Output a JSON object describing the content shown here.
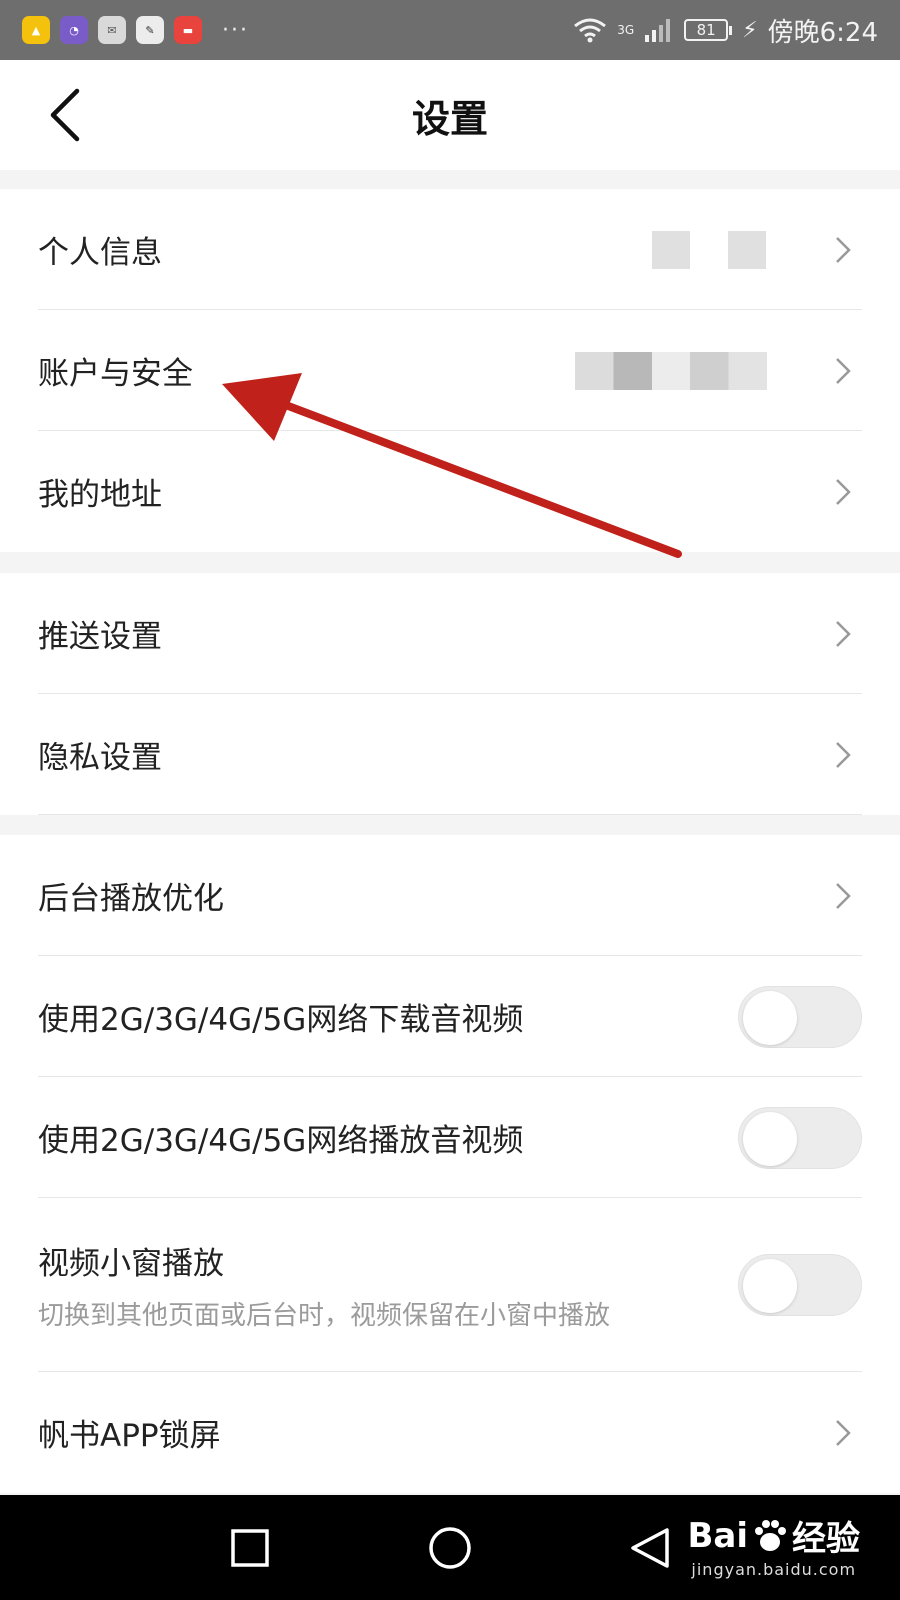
{
  "status_bar": {
    "time": "傍晚6:24",
    "battery": "81",
    "network": "3G"
  },
  "header": {
    "title": "设置"
  },
  "groups": {
    "account": {
      "items": [
        {
          "label": "个人信息"
        },
        {
          "label": "账户与安全"
        },
        {
          "label": "我的地址"
        }
      ]
    },
    "notifications": {
      "items": [
        {
          "label": "推送设置"
        },
        {
          "label": "隐私设置"
        }
      ]
    },
    "playback": {
      "items": [
        {
          "label": "后台播放优化"
        },
        {
          "label": "使用2G/3G/4G/5G网络下载音视频",
          "toggle": "off"
        },
        {
          "label": "使用2G/3G/4G/5G网络播放音视频",
          "toggle": "off"
        },
        {
          "label": "视频小窗播放",
          "sublabel": "切换到其他页面或后台时，视频保留在小窗中播放",
          "toggle": "off"
        },
        {
          "label": "帆书APP锁屏"
        }
      ]
    }
  },
  "watermark": {
    "brand": "Bai",
    "brand_suffix": "经验",
    "url": "jingyan.baidu.com"
  },
  "colors": {
    "annotation_arrow": "#c0221b",
    "toggle_off": "#ececec"
  }
}
